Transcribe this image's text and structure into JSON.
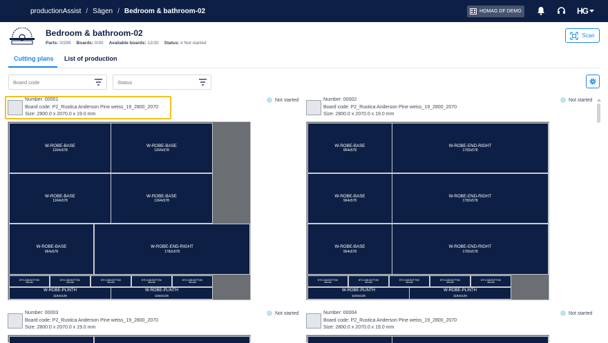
{
  "topbar": {
    "app": "productionAssist",
    "sep1": "/",
    "crumb1": "Sägen",
    "sep2": "/",
    "crumb2": "Bedroom & bathroom-02",
    "homag_label": "HOMAG DF DEMO",
    "logo_text": "HG"
  },
  "header": {
    "title": "Bedroom & bathroom-02",
    "parts_label": "Parts:",
    "parts_value": "0/289",
    "boards_label": "Boards:",
    "boards_value": "0/30",
    "available_label": "Available boards:",
    "available_value": "12/30",
    "status_label": "Status:",
    "status_value": "Not started",
    "scan_label": "Scan"
  },
  "tabs": [
    {
      "label": "Cutting plans",
      "active": true
    },
    {
      "label": "List of production",
      "active": false
    }
  ],
  "filters": {
    "board_code": "Board code",
    "status": "Status"
  },
  "plans": [
    {
      "number": "Number: 00001",
      "board_code": "Board code: P2_Rustica Anderson Pine weiss_19_2800_2070",
      "size": "Size: 2800.0 x 2070.0 x 19.0 mm",
      "status": "Not started"
    },
    {
      "number": "Number: 00002",
      "board_code": "Board code: P2_Rustica Anderson Pine weiss_19_2800_2070",
      "size": "Size: 2800.0 x 2070.0 x 19.0 mm",
      "status": "Not started"
    },
    {
      "number": "Number: 00003",
      "board_code": "Board code: P2_Rustica Anderson Pine weiss_19_2800_2070",
      "size": "Size: 2800.0 x 2070.0 x 19.0 mm",
      "status": "Not started"
    },
    {
      "number": "Number: 00004",
      "board_code": "Board code: P2_Rustica Anderson Pine weiss_19_2800_2070",
      "size": "Size: 2800.0 x 2070.0 x 19.0 mm",
      "status": "Not started"
    }
  ],
  "parts": {
    "wrobe_base": "W-ROBE-BASE",
    "dim_1164": "1164x578",
    "dim_964": "964x578",
    "wrobe_end_right": "W-ROBE-END-RIGHT",
    "dim_1782": "1782x578",
    "bth_cab_bottom": "BTH-CAB-BOTTOM",
    "dim_small": "380x280",
    "plinth": "W-ROBE-PLINTH",
    "dim_plinth": "1164x125"
  },
  "colors": {
    "navy": "#0d1f45",
    "accent": "#1e88e5",
    "highlight": "#f3c018",
    "waste": "#6b6e73",
    "status_dot": "#bde3ec"
  }
}
